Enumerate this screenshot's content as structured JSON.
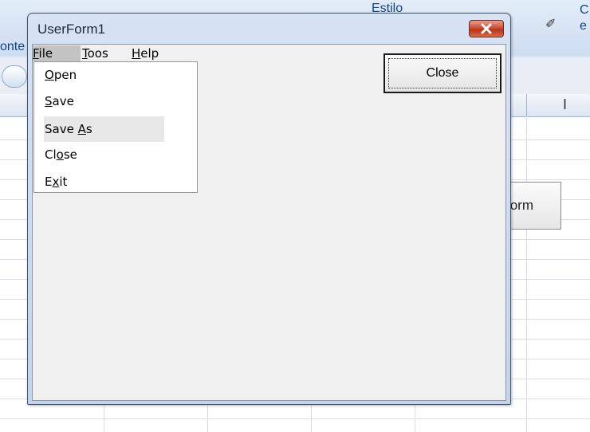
{
  "excel": {
    "ribbon_style_label": "Estilo",
    "ribbon_left_text": "onte",
    "ribbon_right_top": "C",
    "ribbon_right_bottom": "e",
    "column_letter": "I",
    "sheet_button_label": "orm"
  },
  "userform": {
    "title": "UserForm1",
    "menu": [
      {
        "label_pre": "",
        "label_ul": "F",
        "label_post": "ile"
      },
      {
        "label_pre": "",
        "label_ul": "T",
        "label_post": "oos"
      },
      {
        "label_pre": "",
        "label_ul": "H",
        "label_post": "elp"
      }
    ],
    "close_button_label": "Close",
    "file_menu": [
      {
        "pre": "",
        "ul": "O",
        "post": "pen"
      },
      {
        "pre": "",
        "ul": "S",
        "post": "ave"
      },
      {
        "pre": "Save ",
        "ul": "A",
        "post": "s"
      },
      {
        "pre": "Cl",
        "ul": "o",
        "post": "se"
      },
      {
        "pre": "E",
        "ul": "x",
        "post": "it"
      }
    ]
  },
  "colors": {
    "titlebar": "#c3d4eb",
    "close_x": "#c8452b",
    "menu_active": "#c3c3c3",
    "client_bg": "#f0f0f0"
  }
}
